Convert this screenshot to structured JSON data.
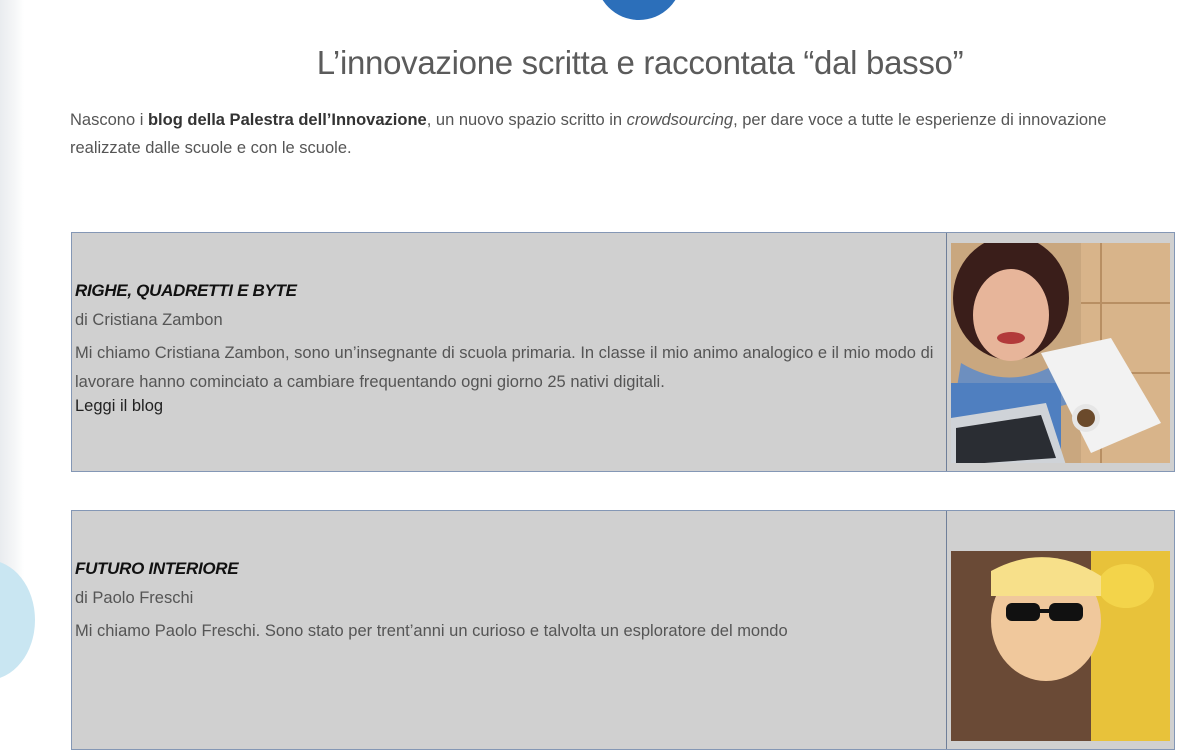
{
  "headline": "L’innovazione scritta e raccontata “dal basso”",
  "intro": {
    "prefix": "Nascono i ",
    "bold": "blog della Palestra dell’Innovazione",
    "middle": ", un nuovo spazio scritto in ",
    "italic": "crowdsourcing",
    "suffix": ", per dare voce a tutte le esperienze di innovazione realizzate dalle scuole e con le scuole."
  },
  "blogs": [
    {
      "title": "RIGHE, QUADRETTI E BYTE",
      "author": "di Cristiana Zambon",
      "description": "Mi chiamo Cristiana Zambon, sono un’insegnante di scuola primaria. In classe il mio animo analogico e il mio modo di lavorare hanno cominciato a cambiare frequentando ogni giorno 25 nativi digitali.",
      "link": "Leggi il blog"
    },
    {
      "title": "FUTURO INTERIORE",
      "author": "di Paolo Freschi",
      "description": "Mi chiamo Paolo Freschi. Sono stato per trent’anni un curioso e talvolta un esploratore del mondo"
    }
  ],
  "colors": {
    "accent": "#2c6fba",
    "card_bg": "#d0d0d0",
    "card_border": "#8497b5"
  }
}
